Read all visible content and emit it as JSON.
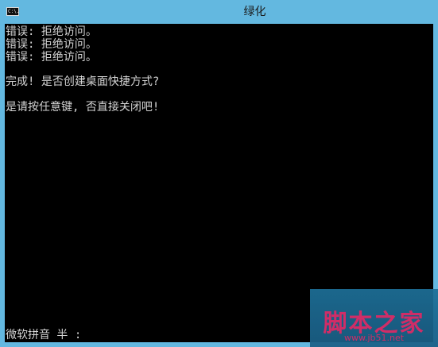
{
  "window": {
    "title": "绿化",
    "icon_label": "C:\\."
  },
  "console": {
    "lines": [
      "错误: 拒绝访问。",
      "错误: 拒绝访问。",
      "错误: 拒绝访问。",
      "",
      "完成! 是否创建桌面快捷方式?",
      "",
      "是请按任意键, 否直接关闭吧!"
    ],
    "ime_status": "微软拼音 半 :"
  },
  "watermark": {
    "main": "脚本之家",
    "url": "www.jb51.net"
  },
  "colors": {
    "titlebar": "#63b8e0",
    "console_bg": "#000000",
    "console_text": "#d4d4d4",
    "watermark_text": "#e0316f"
  }
}
